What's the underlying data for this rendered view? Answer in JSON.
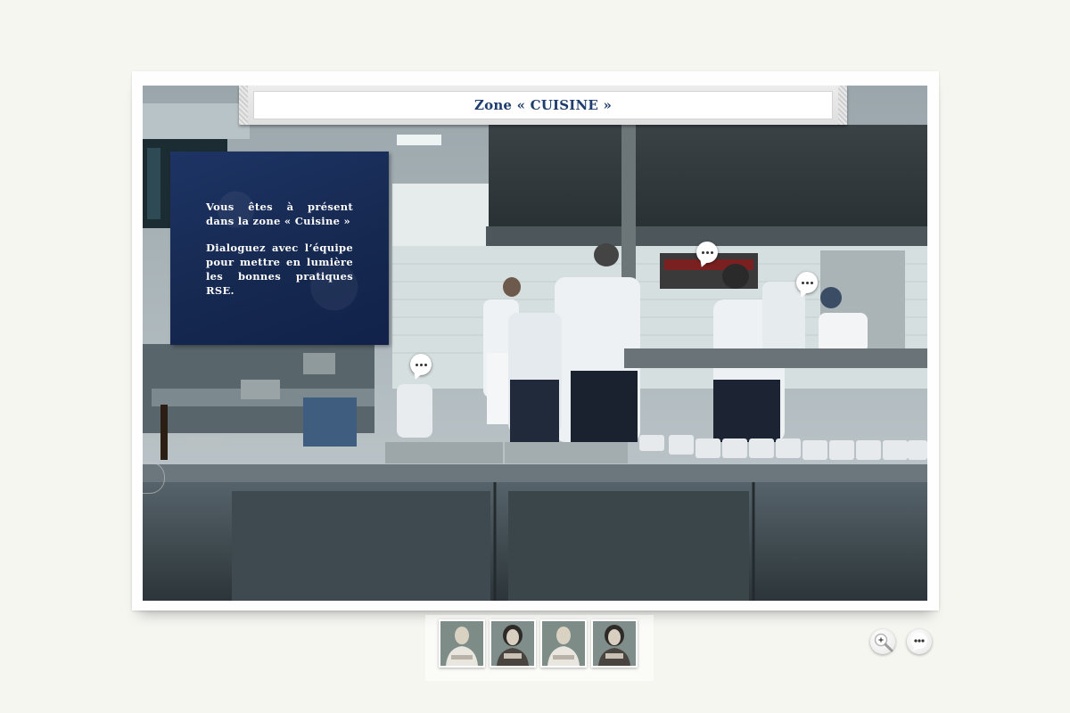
{
  "banner": {
    "title": "Zone « CUISINE »"
  },
  "info_panel": {
    "line1": "Vous êtes à présent dans la zone « Cuisine »",
    "line2": "Dialoguez avec l’équipe pour mettre en lumière les bonnes pratiques RSE."
  },
  "hotspots": [
    {
      "name": "dialogue-hotspot-left",
      "icon": "speech-bubble-icon"
    },
    {
      "name": "dialogue-hotspot-center",
      "icon": "speech-bubble-icon"
    },
    {
      "name": "dialogue-hotspot-right",
      "icon": "speech-bubble-icon"
    }
  ],
  "characters": [
    {
      "name": "character-thumb-1",
      "icon": "person-portrait"
    },
    {
      "name": "character-thumb-2",
      "icon": "person-portrait"
    },
    {
      "name": "character-thumb-3",
      "icon": "person-portrait"
    },
    {
      "name": "character-thumb-4",
      "icon": "person-portrait"
    }
  ],
  "controls": [
    {
      "name": "zoom-button",
      "icon": "magnifier-plus-icon"
    },
    {
      "name": "dialogue-menu-button",
      "icon": "speech-bubble-icon"
    }
  ],
  "colors": {
    "accent_navy": "#1e3d6e",
    "panel_navy": "#15284f",
    "background": "#f6f6f1"
  }
}
